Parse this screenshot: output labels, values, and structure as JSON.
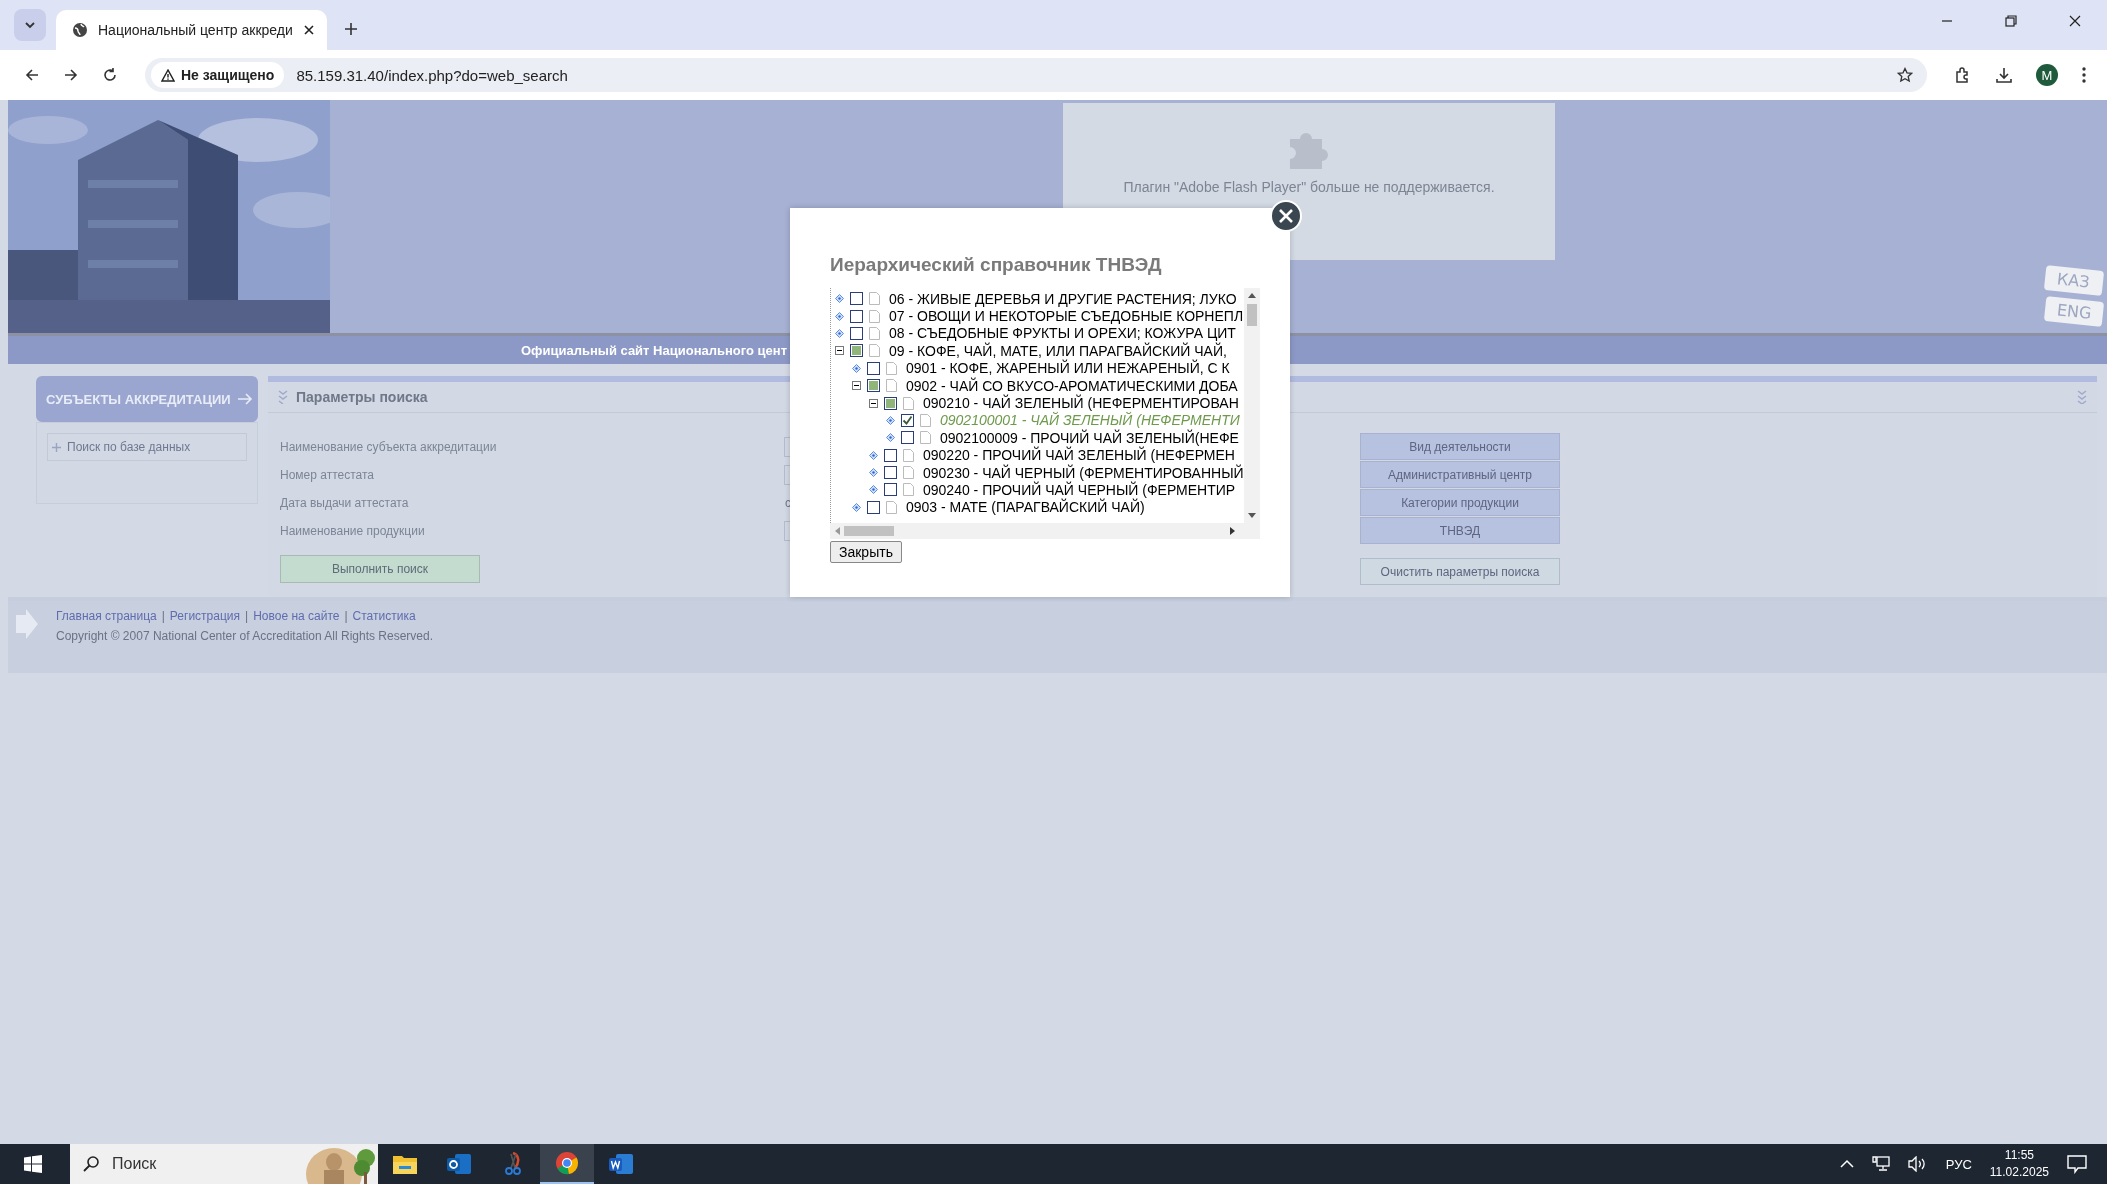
{
  "browser": {
    "tab_title": "Национальный центр аккреди",
    "security_label": "Не защищено",
    "url": "85.159.31.40/index.php?do=web_search",
    "profile_initial": "M"
  },
  "header": {
    "flash_message": "Плагин \"Adobe Flash Player\" больше не поддерживается.",
    "languages": [
      "КАЗ",
      "ENG"
    ],
    "site_title": "Официальный сайт Национального цент"
  },
  "sidebar": {
    "heading": "СУБЪЕКТЫ АККРЕДИТАЦИИ",
    "items": [
      {
        "label": "Поиск по базе данных"
      }
    ]
  },
  "search_panel": {
    "title": "Параметры поиска",
    "fields": [
      {
        "label": "Наименование субъекта аккредитации",
        "kind": "text"
      },
      {
        "label": "Номер аттестата",
        "kind": "text"
      },
      {
        "label": "Дата выдачи аттестата",
        "kind": "date",
        "prefix": "с"
      },
      {
        "label": "Наименование продукции",
        "kind": "text"
      }
    ],
    "submit": "Выполнить поиск",
    "filter_buttons": [
      "Вид деятельности",
      "Административный центр",
      "Категории продукции",
      "ТНВЭД"
    ],
    "clear": "Очистить параметры поиска"
  },
  "footer": {
    "links": [
      {
        "label": "Главная страница",
        "separator": "|"
      },
      {
        "label": "Регистрация",
        "separator": "|"
      },
      {
        "label": "Новое на сайте",
        "separator": "|"
      },
      {
        "label": "Статистика"
      }
    ],
    "copyright": "Copyright © 2007 National Center of Accreditation All Rights Reserved."
  },
  "dialog": {
    "title": "Иерархический справочник ТНВЭД",
    "close_button": "Закрыть",
    "tree": [
      {
        "label": "06 - ЖИВЫЕ ДЕРЕВЬЯ И ДРУГИЕ РАСТЕНИЯ; ЛУКО",
        "expanded": false,
        "checked": false,
        "partial": false
      },
      {
        "label": "07 - ОВОЩИ И НЕКОТОРЫЕ СЪЕДОБНЫЕ КОРНЕПЛ",
        "expanded": false,
        "checked": false,
        "partial": false
      },
      {
        "label": "08 - СЪЕДОБНЫЕ ФРУКТЫ И ОРЕХИ; КОЖУРА ЦИТ",
        "expanded": false,
        "checked": false,
        "partial": false
      },
      {
        "label": "09 - КОФЕ, ЧАЙ, МАТЕ, ИЛИ ПАРАГВАЙСКИЙ ЧАЙ,",
        "expanded": true,
        "checked": false,
        "partial": true,
        "children": [
          {
            "label": "0901 - КОФЕ, ЖАРЕНЫЙ ИЛИ НЕЖАРЕНЫЙ, С К",
            "expanded": false,
            "checked": false,
            "partial": false
          },
          {
            "label": "0902 - ЧАЙ СО ВКУСО-АРОМАТИЧЕСКИМИ ДОБА",
            "expanded": true,
            "checked": false,
            "partial": true,
            "children": [
              {
                "label": "090210 - ЧАЙ ЗЕЛЕНЫЙ (НЕФЕРМЕНТИРОВАН",
                "expanded": true,
                "checked": false,
                "partial": true,
                "children": [
                  {
                    "label": "0902100001 - ЧАЙ ЗЕЛЕНЫЙ (НЕФЕРМЕНТИ",
                    "expanded": false,
                    "checked": true,
                    "partial": false
                  },
                  {
                    "label": "0902100009 - ПРОЧИЙ ЧАЙ ЗЕЛЕНЫЙ(НЕФЕ",
                    "expanded": false,
                    "checked": false,
                    "partial": false
                  }
                ]
              },
              {
                "label": "090220 - ПРОЧИЙ ЧАЙ ЗЕЛЕНЫЙ (НЕФЕРМЕН",
                "expanded": false,
                "checked": false,
                "partial": false
              },
              {
                "label": "090230 - ЧАЙ ЧЕРНЫЙ (ФЕРМЕНТИРОВАННЫЙ",
                "expanded": false,
                "checked": false,
                "partial": false
              },
              {
                "label": "090240 - ПРОЧИЙ ЧАЙ ЧЕРНЫЙ (ФЕРМЕНТИР",
                "expanded": false,
                "checked": false,
                "partial": false
              }
            ]
          },
          {
            "label": "0903 - МАТЕ (ПАРАГВАЙСКИЙ ЧАЙ)",
            "expanded": false,
            "checked": false,
            "partial": false
          }
        ]
      }
    ]
  },
  "taskbar": {
    "search_placeholder": "Поиск",
    "apps": [
      {
        "kind": "explorer",
        "active": false
      },
      {
        "kind": "outlook",
        "active": false
      },
      {
        "kind": "snipping",
        "active": false
      },
      {
        "kind": "chrome",
        "active": true
      },
      {
        "kind": "word",
        "active": false
      }
    ],
    "language": "РУС",
    "time": "11:55",
    "date": "11.02.2025"
  }
}
